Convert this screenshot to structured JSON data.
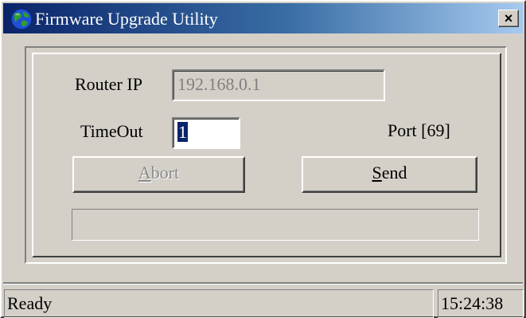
{
  "window": {
    "title": "Firmware Upgrade Utility",
    "close_label": "×",
    "icon": "globe-icon"
  },
  "form": {
    "router_ip_label": "Router IP",
    "router_ip_value": "192.168.0.1",
    "timeout_label": "TimeOut",
    "timeout_value": "1",
    "port_label": "Port [69]"
  },
  "buttons": {
    "abort": {
      "label": "Abort",
      "accel": "A",
      "rest": "bort",
      "enabled": false
    },
    "send": {
      "label": "Send",
      "accel": "S",
      "rest": "end",
      "enabled": true
    }
  },
  "progress": {
    "value_percent": 0
  },
  "statusbar": {
    "status": "Ready",
    "time": "15:24:38"
  },
  "colors": {
    "face": "#d4d0c8",
    "titlebar_start": "#0a246a",
    "titlebar_end": "#a6caf0",
    "selection": "#0a246a"
  }
}
